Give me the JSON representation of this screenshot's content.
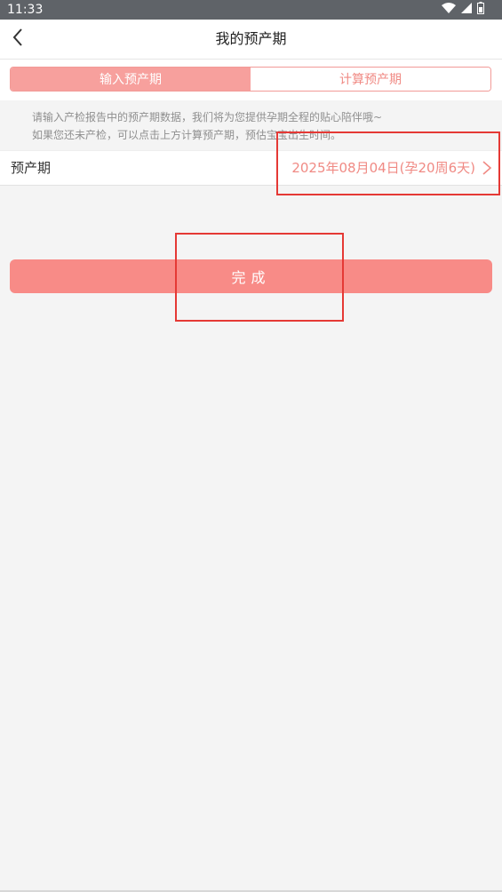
{
  "status_bar": {
    "time": "11:33",
    "icons": [
      "wifi-icon",
      "signal-icon",
      "battery-icon"
    ]
  },
  "header": {
    "back_icon": "back-arrow-icon",
    "title": "我的预产期"
  },
  "tabs": [
    {
      "label": "输入预产期",
      "active": true
    },
    {
      "label": "计算预产期",
      "active": false
    }
  ],
  "hint": {
    "line1": "请输入产检报告中的预产期数据，我们将为您提供孕期全程的贴心陪伴哦~",
    "line2": "如果您还未产检，可以点击上方计算预产期，预估宝宝出生时间。"
  },
  "due_date": {
    "label": "预产期",
    "value": "2025年08月04日(孕20周6天)",
    "chevron_icon": "chevron-right-icon"
  },
  "done_button": {
    "label": "完成"
  },
  "colors": {
    "accent": "#f88b87",
    "tab_active_bg": "#f7a09d",
    "accent_text": "#f08a84",
    "annotation": "#e53935",
    "background": "#f4f4f4",
    "status_bar": "#5f6368"
  }
}
